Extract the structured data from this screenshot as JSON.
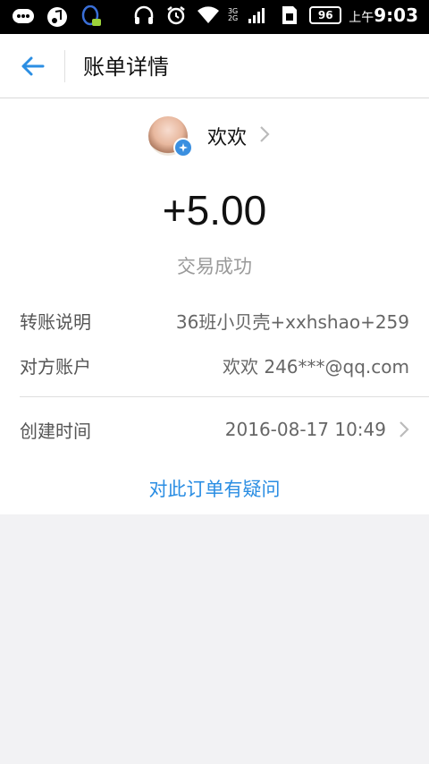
{
  "status_bar": {
    "battery": "96",
    "time_prefix": "上午",
    "time": "9:03",
    "net_top": "3G",
    "net_bottom": "2G"
  },
  "header": {
    "title": "账单详情"
  },
  "payee": {
    "name": "欢欢"
  },
  "transaction": {
    "amount": "+5.00",
    "status": "交易成功"
  },
  "details": {
    "note_label": "转账说明",
    "note_value": "36班小贝壳+xxhshao+259",
    "account_label": "对方账户",
    "account_value": "欢欢 246***@qq.com",
    "time_label": "创建时间",
    "time_value": "2016-08-17 10:49"
  },
  "actions": {
    "question_link": "对此订单有疑问"
  },
  "colors": {
    "accent": "#2b8ee3",
    "background": "#f2f2f4",
    "badge": "#3a8fe0"
  }
}
